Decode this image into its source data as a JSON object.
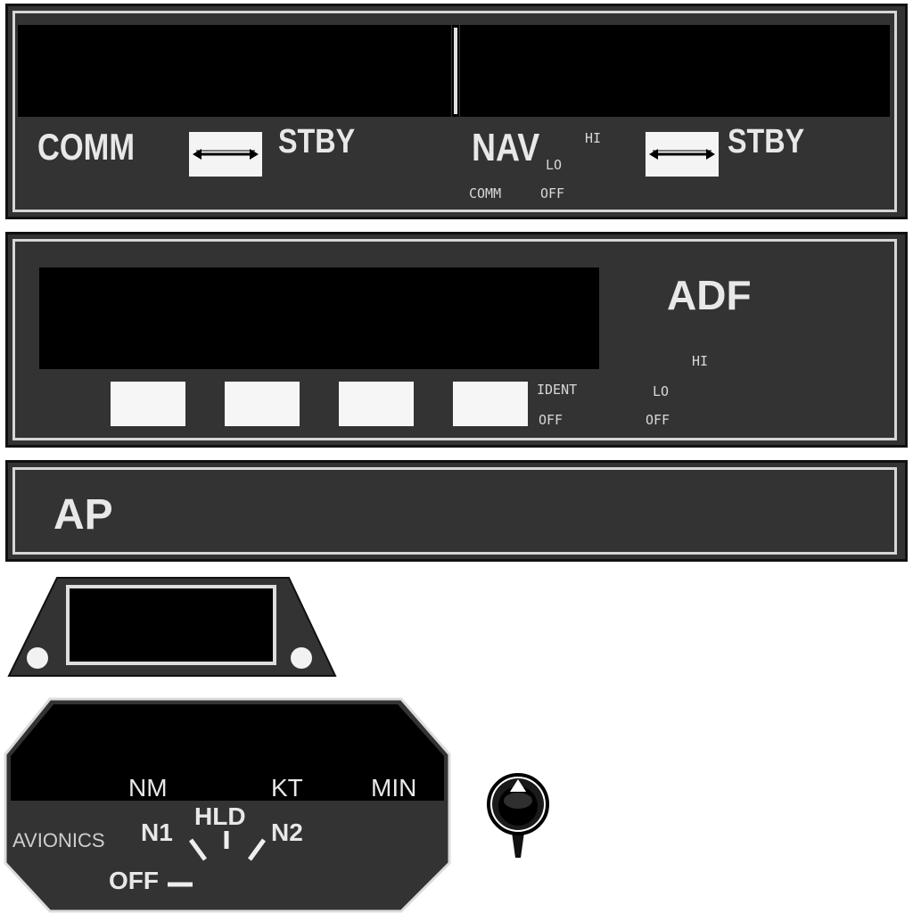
{
  "radio": {
    "comm_label": "COMM",
    "comm_stby_label": "STBY",
    "nav_label": "NAV",
    "nav_stby_label": "STBY",
    "volume_hi": "HI",
    "volume_lo": "LO",
    "volume_comm": "COMM",
    "volume_off": "OFF"
  },
  "adf": {
    "title": "ADF",
    "ident_label": "IDENT",
    "ident_off": "OFF",
    "volume_hi": "HI",
    "volume_lo": "LO",
    "volume_off": "OFF",
    "buttons": [
      "",
      "",
      "",
      ""
    ]
  },
  "autopilot": {
    "title": "AP"
  },
  "dme": {
    "unit_nm": "NM",
    "unit_kt": "KT",
    "unit_min": "MIN",
    "avionics_label": "AVIONICS",
    "pos_n1": "N1",
    "pos_hld": "HLD",
    "pos_n2": "N2",
    "pos_off": "OFF"
  },
  "colors": {
    "panel": "#333333",
    "screen": "#000000",
    "label": "#e8e8e8",
    "button": "#f6f6f6"
  },
  "icons": [
    "swap-arrow-icon",
    "knob-pointer-icon"
  ]
}
